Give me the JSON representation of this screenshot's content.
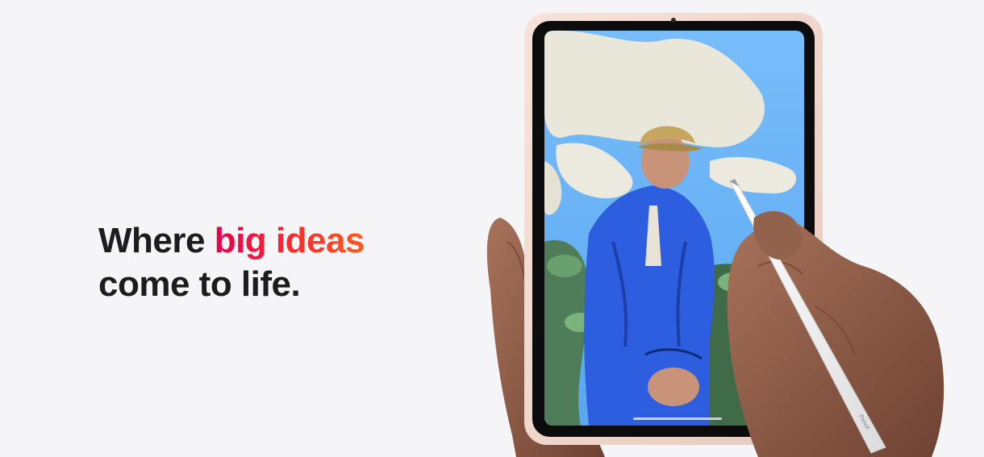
{
  "hero": {
    "headline_prefix": "Where ",
    "headline_accent": "big ideas",
    "headline_line2": "come to life.",
    "pencil_label": "Pencil",
    "accent_gradient": [
      "#e6004c",
      "#ff2d2d",
      "#ff5a1f"
    ]
  },
  "colors": {
    "background": "#f5f5f7",
    "text": "#1d1d1f",
    "device_frame": "#f2d9cf",
    "sky": "#6fb4f5"
  }
}
